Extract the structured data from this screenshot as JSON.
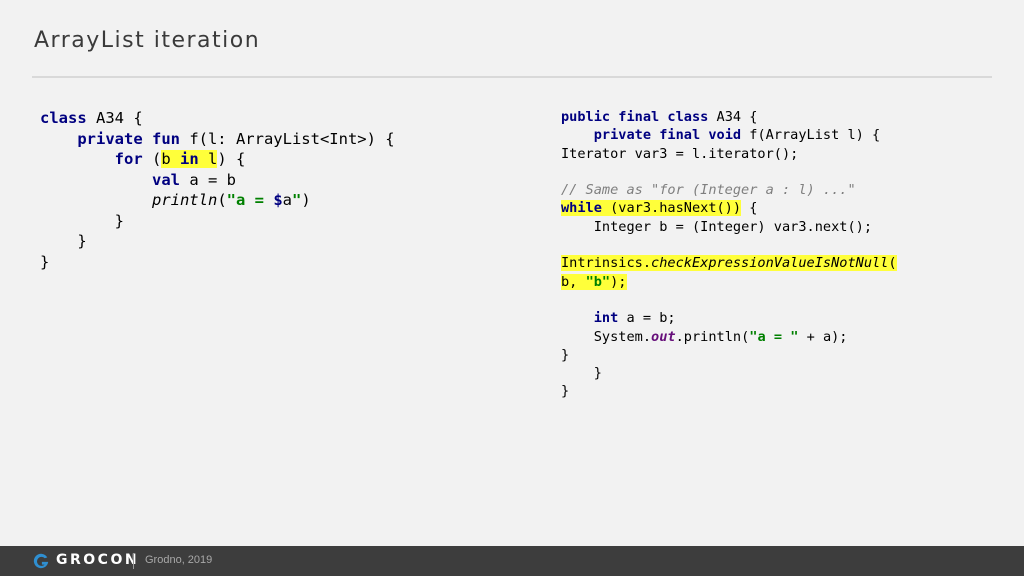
{
  "slide": {
    "title": "ArrayList iteration"
  },
  "kotlin": {
    "l1": {
      "kw": "class",
      "rest": " A34 {"
    },
    "l2": {
      "kw1": "private fun",
      "rest": " f(l: ArrayList<Int>) {"
    },
    "l3": {
      "kw": "for",
      "open": " (",
      "hl_var": "b ",
      "hl_kw": "in",
      "hl_obj": " l",
      "close": ") {"
    },
    "l4": {
      "kw": "val",
      "rest": " a = b"
    },
    "l5": {
      "fn": "println",
      "open": "(",
      "str1": "\"a = ",
      "tpl": "$",
      "tplvar": "a",
      "str2": "\"",
      "close": ")"
    },
    "l6": "}",
    "l7": "}",
    "l8": "}"
  },
  "java": {
    "l1": {
      "kw": "public final class",
      "rest": " A34 {"
    },
    "l2": {
      "kw": "private final void",
      "rest": " f(ArrayList l) {"
    },
    "l3": "Iterator var3 = l.iterator();",
    "l4": "// Same as \"for (Integer a : l) ...\"",
    "l5": {
      "kw": "while",
      "hl_rest": " (var3.hasNext())",
      "rest": " {"
    },
    "l6": "Integer b = (Integer) var3.next();",
    "l7": {
      "obj": "Intrinsics.",
      "method": "checkExpressionValueIsNotNull",
      "open": "("
    },
    "l8": {
      "arg": "b, ",
      "str": "\"b\"",
      "close": ");"
    },
    "l9": {
      "kw": "int",
      "rest": " a = b;"
    },
    "l10": {
      "obj": "System.",
      "field": "out",
      "call": ".println(",
      "str": "\"a = \"",
      "rest": " + a);"
    },
    "l11": "}",
    "l12": "}",
    "l13": "}"
  },
  "footer": {
    "brand": "GROCON",
    "event": "Grodno, 2019",
    "logo_icon": "grocon-g-logo-icon",
    "logo_color": "#2f8fd1"
  },
  "colors": {
    "highlight": "#ffff3a",
    "keyword": "#000080",
    "string": "#008000",
    "comment": "#7f7f7f",
    "field": "#660e7a"
  }
}
